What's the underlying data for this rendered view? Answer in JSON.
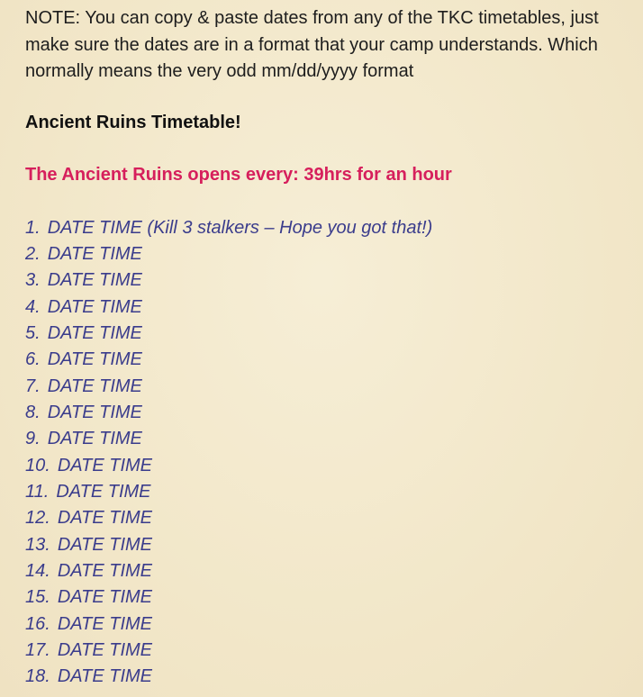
{
  "note": "NOTE: You can copy & paste dates from any of the TKC timetables, just make sure the dates are in a format that your camp understands. Which normally means the very odd mm/dd/yyyy format",
  "heading": "Ancient Ruins Timetable!",
  "opens_text": "The Ancient Ruins opens every: 39hrs for an hour",
  "timetable": [
    {
      "num": "1.",
      "text": "DATE TIME (Kill 3 stalkers – Hope you got that!)"
    },
    {
      "num": "2.",
      "text": "DATE TIME"
    },
    {
      "num": "3.",
      "text": "DATE TIME"
    },
    {
      "num": "4.",
      "text": "DATE TIME"
    },
    {
      "num": "5.",
      "text": "DATE TIME"
    },
    {
      "num": "6.",
      "text": "DATE TIME"
    },
    {
      "num": "7.",
      "text": "DATE TIME"
    },
    {
      "num": "8.",
      "text": "DATE TIME"
    },
    {
      "num": "9.",
      "text": "DATE TIME"
    },
    {
      "num": "10.",
      "text": "DATE TIME"
    },
    {
      "num": "11.",
      "text": "DATE TIME"
    },
    {
      "num": "12.",
      "text": "DATE TIME"
    },
    {
      "num": "13.",
      "text": "DATE TIME"
    },
    {
      "num": "14.",
      "text": "DATE TIME"
    },
    {
      "num": "15.",
      "text": "DATE TIME"
    },
    {
      "num": "16.",
      "text": "DATE TIME"
    },
    {
      "num": "17.",
      "text": "DATE TIME"
    },
    {
      "num": "18.",
      "text": "DATE TIME"
    }
  ],
  "colors": {
    "background": "#f3e9cd",
    "note_text": "#1d1d1d",
    "heading_text": "#111111",
    "opens_text": "#d61f5c",
    "list_text": "#3a3c8c"
  }
}
